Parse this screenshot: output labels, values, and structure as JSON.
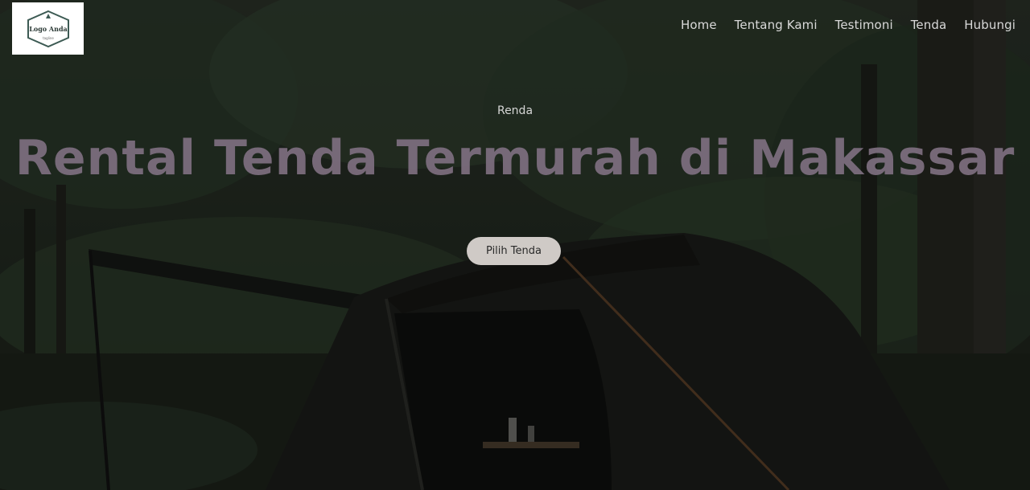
{
  "logo": {
    "text": "Logo Anda",
    "tagline": "tagline"
  },
  "nav": {
    "items": [
      "Home",
      "Tentang Kami",
      "Testimoni",
      "Tenda",
      "Hubungi"
    ]
  },
  "hero": {
    "subtitle": "Renda",
    "title": "Rental Tenda Termurah di Makassar",
    "button_label": "Pilih Tenda"
  },
  "colors": {
    "overlay": "#1c1f1a",
    "title": "#7e6f80",
    "button_bg": "#cfcac6"
  }
}
